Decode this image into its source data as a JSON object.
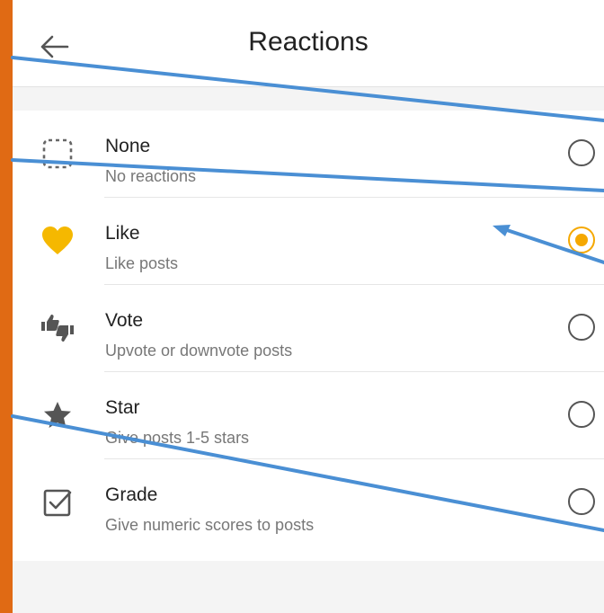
{
  "appbar": {
    "title": "Reactions",
    "back_icon": "arrow-left-icon"
  },
  "options": [
    {
      "key": "none",
      "label": "None",
      "description": "No reactions",
      "icon": "dashed-square-icon",
      "selected": false
    },
    {
      "key": "like",
      "label": "Like",
      "description": "Like posts",
      "icon": "heart-icon",
      "selected": true
    },
    {
      "key": "vote",
      "label": "Vote",
      "description": "Upvote or downvote posts",
      "icon": "thumbs-up-down-icon",
      "selected": false
    },
    {
      "key": "star",
      "label": "Star",
      "description": "Give posts 1-5 stars",
      "icon": "star-icon",
      "selected": false
    },
    {
      "key": "grade",
      "label": "Grade",
      "description": "Give numeric scores to posts",
      "icon": "checkbox-icon",
      "selected": false
    }
  ],
  "colors": {
    "accent": "#f5a800",
    "frame": "#e06a14",
    "annotation": "#4a8fd4"
  }
}
